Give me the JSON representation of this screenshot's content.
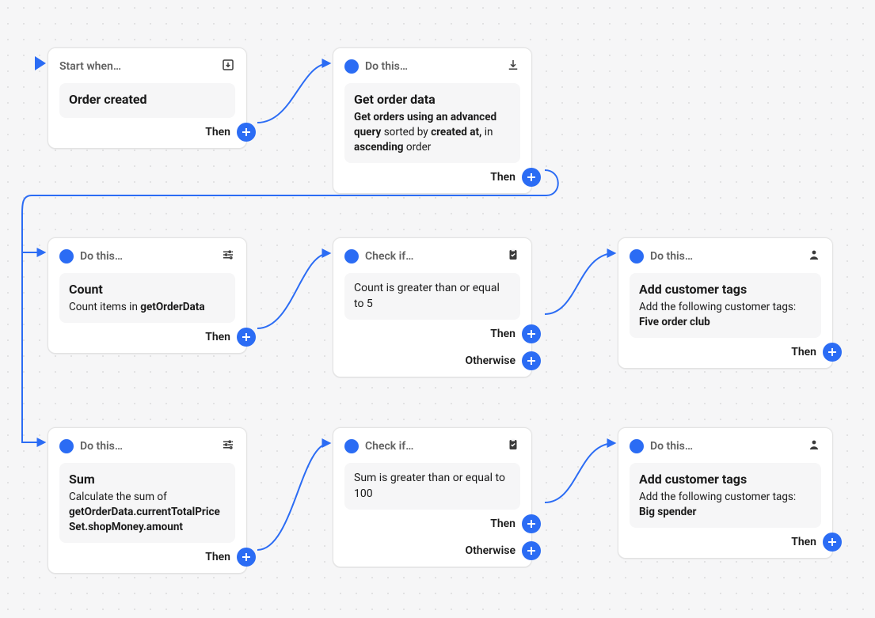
{
  "labels": {
    "startHeader": "Start when…",
    "doThis": "Do this…",
    "checkIf": "Check if…",
    "then": "Then",
    "otherwise": "Otherwise"
  },
  "start": {
    "trigger": "Order created"
  },
  "getOrder": {
    "title": "Get order data",
    "desc_part1": "Get orders using an advanced query",
    "desc_sortedBy": "sorted by",
    "desc_field": "created at,",
    "desc_in": "in",
    "desc_dir": "ascending",
    "desc_order": "order"
  },
  "count": {
    "title": "Count",
    "desc_prefix": "Count items in ",
    "desc_bold": "getOrderData"
  },
  "check5": {
    "text": "Count is greater than or equal to 5"
  },
  "tag5": {
    "title": "Add customer tags",
    "desc": "Add the following customer tags:",
    "tag": "Five order club"
  },
  "sum": {
    "title": "Sum",
    "desc_prefix": "Calculate the sum of ",
    "desc_bold": "getOrderData.currentTotalPriceSet.shopMoney.amount"
  },
  "check100": {
    "text": "Sum is greater than or equal to 100"
  },
  "tagBig": {
    "title": "Add customer tags",
    "desc": "Add the following customer tags:",
    "tag": "Big spender"
  }
}
